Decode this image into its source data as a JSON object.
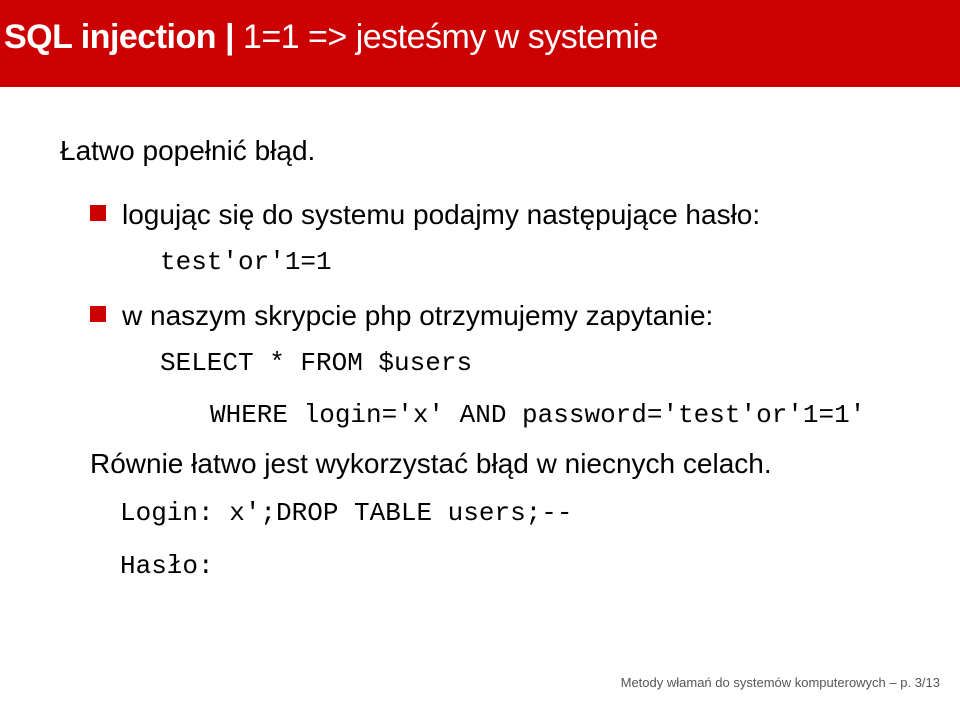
{
  "header": {
    "title_main": "SQL injection",
    "separator": " | ",
    "title_sub": "1=1 => jesteśmy w systemie"
  },
  "content": {
    "intro": "Łatwo popełnić błąd.",
    "bullet1": "logując się do systemu podajmy następujące hasło:",
    "code1": "test'or'1=1",
    "bullet2": "w naszym skrypcie php otrzymujemy zapytanie:",
    "code2a": "SELECT * FROM $users",
    "code2b": "WHERE login='x' AND password='test'or'1=1'",
    "plain1": "Równie łatwo jest wykorzystać błąd w niecnych celach.",
    "code3": "Login: x';DROP TABLE users;--",
    "code4": "Hasło:"
  },
  "footer": {
    "text": "Metody włamań do systemów komputerowych – p. 3/13"
  }
}
